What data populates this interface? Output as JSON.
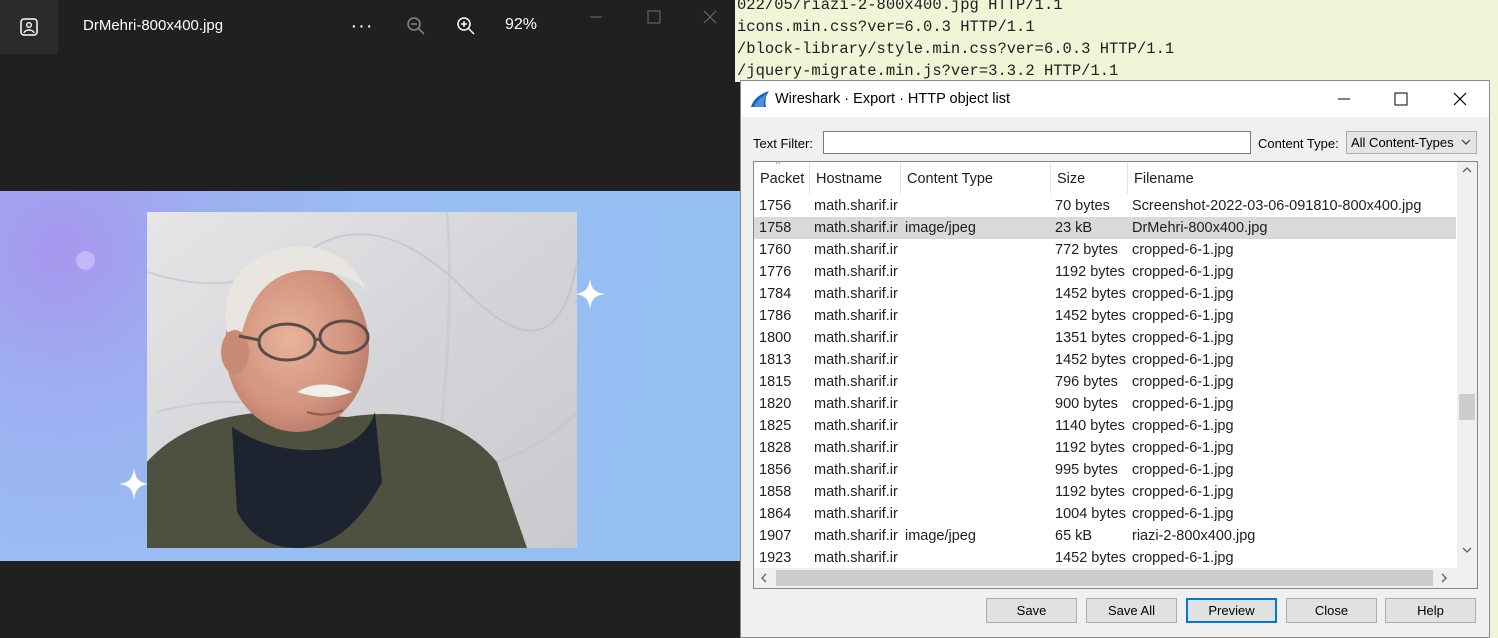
{
  "viewer": {
    "filename": "DrMehri-800x400.jpg",
    "more_label": "···",
    "zoom_level": "92%"
  },
  "terminal": {
    "lines": [
      "022/05/riazi-2-800x400.jpg HTTP/1.1",
      "icons.min.css?ver=6.0.3 HTTP/1.1",
      "/block-library/style.min.css?ver=6.0.3 HTTP/1.1",
      "/jquery-migrate.min.js?ver=3.3.2 HTTP/1.1"
    ]
  },
  "dialog": {
    "title": "Wireshark · Export · HTTP object list",
    "text_filter_label": "Text Filter:",
    "text_filter_value": "",
    "content_type_label": "Content Type:",
    "content_type_value": "All Content-Types",
    "columns": [
      "Packet",
      "Hostname",
      "Content Type",
      "Size",
      "Filename"
    ],
    "rows": [
      {
        "packet": "1756",
        "hostname": "math.sharif.ir",
        "content_type": "",
        "size": "70 bytes",
        "filename": "Screenshot-2022-03-06-091810-800x400.jpg"
      },
      {
        "packet": "1758",
        "hostname": "math.sharif.ir",
        "content_type": "image/jpeg",
        "size": "23 kB",
        "filename": "DrMehri-800x400.jpg"
      },
      {
        "packet": "1760",
        "hostname": "math.sharif.ir",
        "content_type": "",
        "size": "772 bytes",
        "filename": "cropped-6-1.jpg"
      },
      {
        "packet": "1776",
        "hostname": "math.sharif.ir",
        "content_type": "",
        "size": "1192 bytes",
        "filename": "cropped-6-1.jpg"
      },
      {
        "packet": "1784",
        "hostname": "math.sharif.ir",
        "content_type": "",
        "size": "1452 bytes",
        "filename": "cropped-6-1.jpg"
      },
      {
        "packet": "1786",
        "hostname": "math.sharif.ir",
        "content_type": "",
        "size": "1452 bytes",
        "filename": "cropped-6-1.jpg"
      },
      {
        "packet": "1800",
        "hostname": "math.sharif.ir",
        "content_type": "",
        "size": "1351 bytes",
        "filename": "cropped-6-1.jpg"
      },
      {
        "packet": "1813",
        "hostname": "math.sharif.ir",
        "content_type": "",
        "size": "1452 bytes",
        "filename": "cropped-6-1.jpg"
      },
      {
        "packet": "1815",
        "hostname": "math.sharif.ir",
        "content_type": "",
        "size": "796 bytes",
        "filename": "cropped-6-1.jpg"
      },
      {
        "packet": "1820",
        "hostname": "math.sharif.ir",
        "content_type": "",
        "size": "900 bytes",
        "filename": "cropped-6-1.jpg"
      },
      {
        "packet": "1825",
        "hostname": "math.sharif.ir",
        "content_type": "",
        "size": "1140 bytes",
        "filename": "cropped-6-1.jpg"
      },
      {
        "packet": "1828",
        "hostname": "math.sharif.ir",
        "content_type": "",
        "size": "1192 bytes",
        "filename": "cropped-6-1.jpg"
      },
      {
        "packet": "1856",
        "hostname": "math.sharif.ir",
        "content_type": "",
        "size": "995 bytes",
        "filename": "cropped-6-1.jpg"
      },
      {
        "packet": "1858",
        "hostname": "math.sharif.ir",
        "content_type": "",
        "size": "1192 bytes",
        "filename": "cropped-6-1.jpg"
      },
      {
        "packet": "1864",
        "hostname": "math.sharif.ir",
        "content_type": "",
        "size": "1004 bytes",
        "filename": "cropped-6-1.jpg"
      },
      {
        "packet": "1907",
        "hostname": "math.sharif.ir",
        "content_type": "image/jpeg",
        "size": "65 kB",
        "filename": "riazi-2-800x400.jpg"
      },
      {
        "packet": "1923",
        "hostname": "math.sharif.ir",
        "content_type": "",
        "size": "1452 bytes",
        "filename": "cropped-6-1.jpg"
      }
    ],
    "selected_packet": "1758",
    "buttons": {
      "save": "Save",
      "save_all": "Save All",
      "preview": "Preview",
      "close": "Close",
      "help": "Help"
    }
  },
  "colors": {
    "viewer_bg": "#202020",
    "photo_bg": "#95c0f2",
    "terminal_bg": "#eef6d7",
    "selection": "#d9d9d9",
    "focus_border": "#0078d7",
    "wireshark_fin": "#1560b8"
  },
  "icons": [
    "gallery-icon",
    "more-icon",
    "zoom-out-icon",
    "zoom-in-icon",
    "minimize-icon",
    "maximize-icon",
    "close-icon",
    "wireshark-fin-icon",
    "chevron-down-icon",
    "scroll-up-icon",
    "scroll-down-icon",
    "scroll-left-icon",
    "scroll-right-icon"
  ]
}
